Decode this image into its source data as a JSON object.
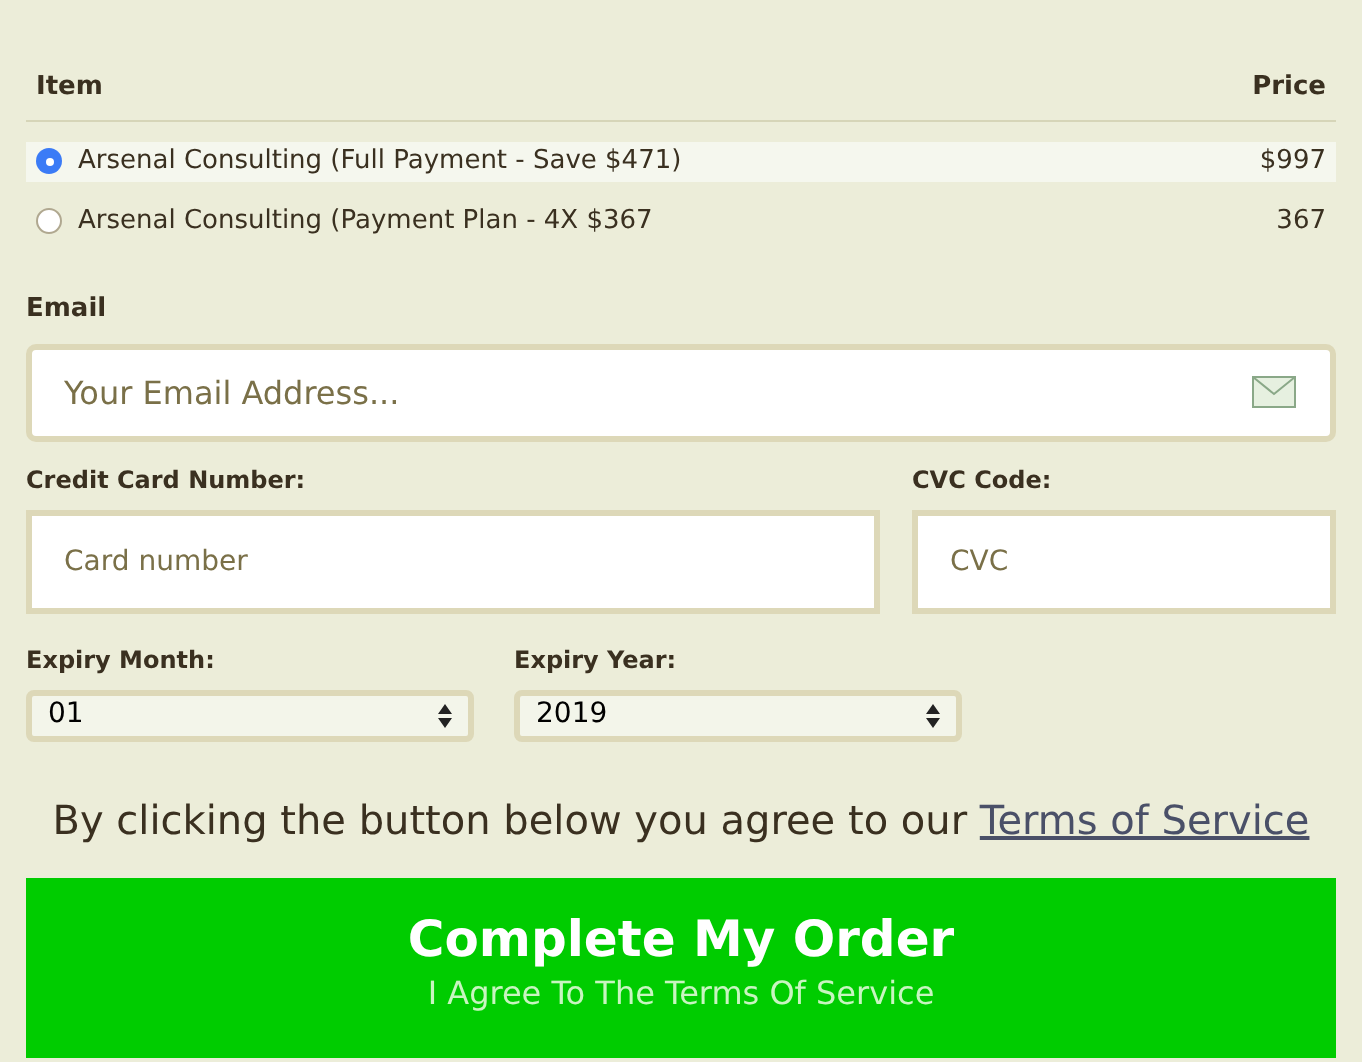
{
  "table": {
    "columns": [
      "Item",
      "Price"
    ],
    "rows": [
      {
        "item": "Arsenal Consulting (Full Payment - Save $471)",
        "price": "$997",
        "selected": true
      },
      {
        "item": "Arsenal Consulting (Payment Plan - 4X $367",
        "price": "367",
        "selected": false
      }
    ]
  },
  "email": {
    "label": "Email",
    "placeholder": "Your Email Address..."
  },
  "card": {
    "label": "Credit Card Number:",
    "placeholder": "Card number"
  },
  "cvc": {
    "label": "CVC Code:",
    "placeholder": "CVC"
  },
  "expiry_month": {
    "label": "Expiry Month:",
    "value": "01"
  },
  "expiry_year": {
    "label": "Expiry Year:",
    "value": "2019"
  },
  "agreement": {
    "text": "By clicking the button below you agree to our",
    "link": "Terms of Service"
  },
  "submit": {
    "title": "Complete My Order",
    "subtitle": "I Agree To The Terms Of Service"
  }
}
